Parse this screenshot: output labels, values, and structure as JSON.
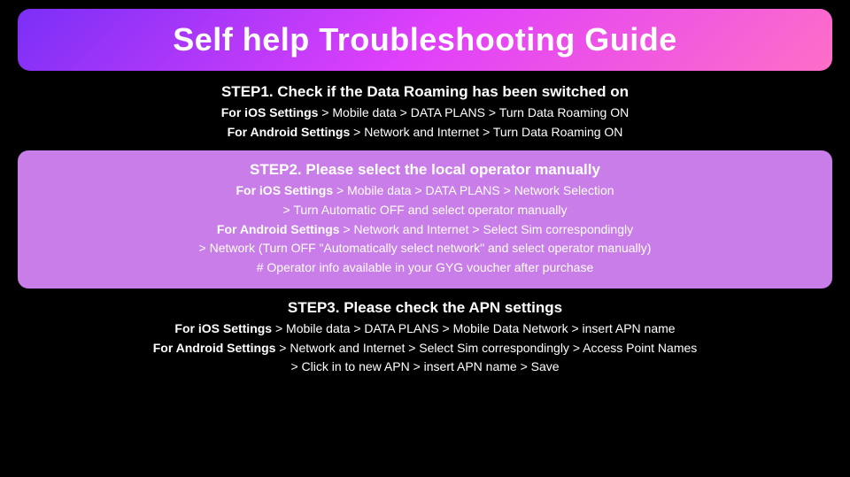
{
  "title": "Self help Troubleshooting Guide",
  "step1": {
    "heading": "STEP1. Check if the Data Roaming has been switched on",
    "ios_label": "For iOS Settings",
    "ios_text": " > Mobile data > DATA PLANS > Turn Data Roaming ON",
    "android_label": "For Android Settings",
    "android_text": " > Network and Internet > Turn Data Roaming ON"
  },
  "step2": {
    "heading": "STEP2. Please select the local operator manually",
    "ios_label": "For iOS Settings",
    "ios_text": " > Mobile data > DATA PLANS > Network Selection",
    "ios_line2": "> Turn Automatic OFF and select operator manually",
    "android_label": "For Android Settings",
    "android_text": " > Network and Internet > Select Sim correspondingly",
    "android_line2": "> Network (Turn OFF \"Automatically select network\" and select operator manually)",
    "note": "# Operator info available in your GYG voucher after purchase"
  },
  "step3": {
    "heading": "STEP3. Please check the APN settings",
    "ios_label": "For iOS Settings",
    "ios_text": " > Mobile data > DATA PLANS > Mobile Data Network > insert APN name",
    "android_label": "For Android Settings",
    "android_text": " > Network and Internet > Select Sim correspondingly > Access Point Names",
    "android_line2": "> Click in to new APN > insert APN name > Save"
  }
}
